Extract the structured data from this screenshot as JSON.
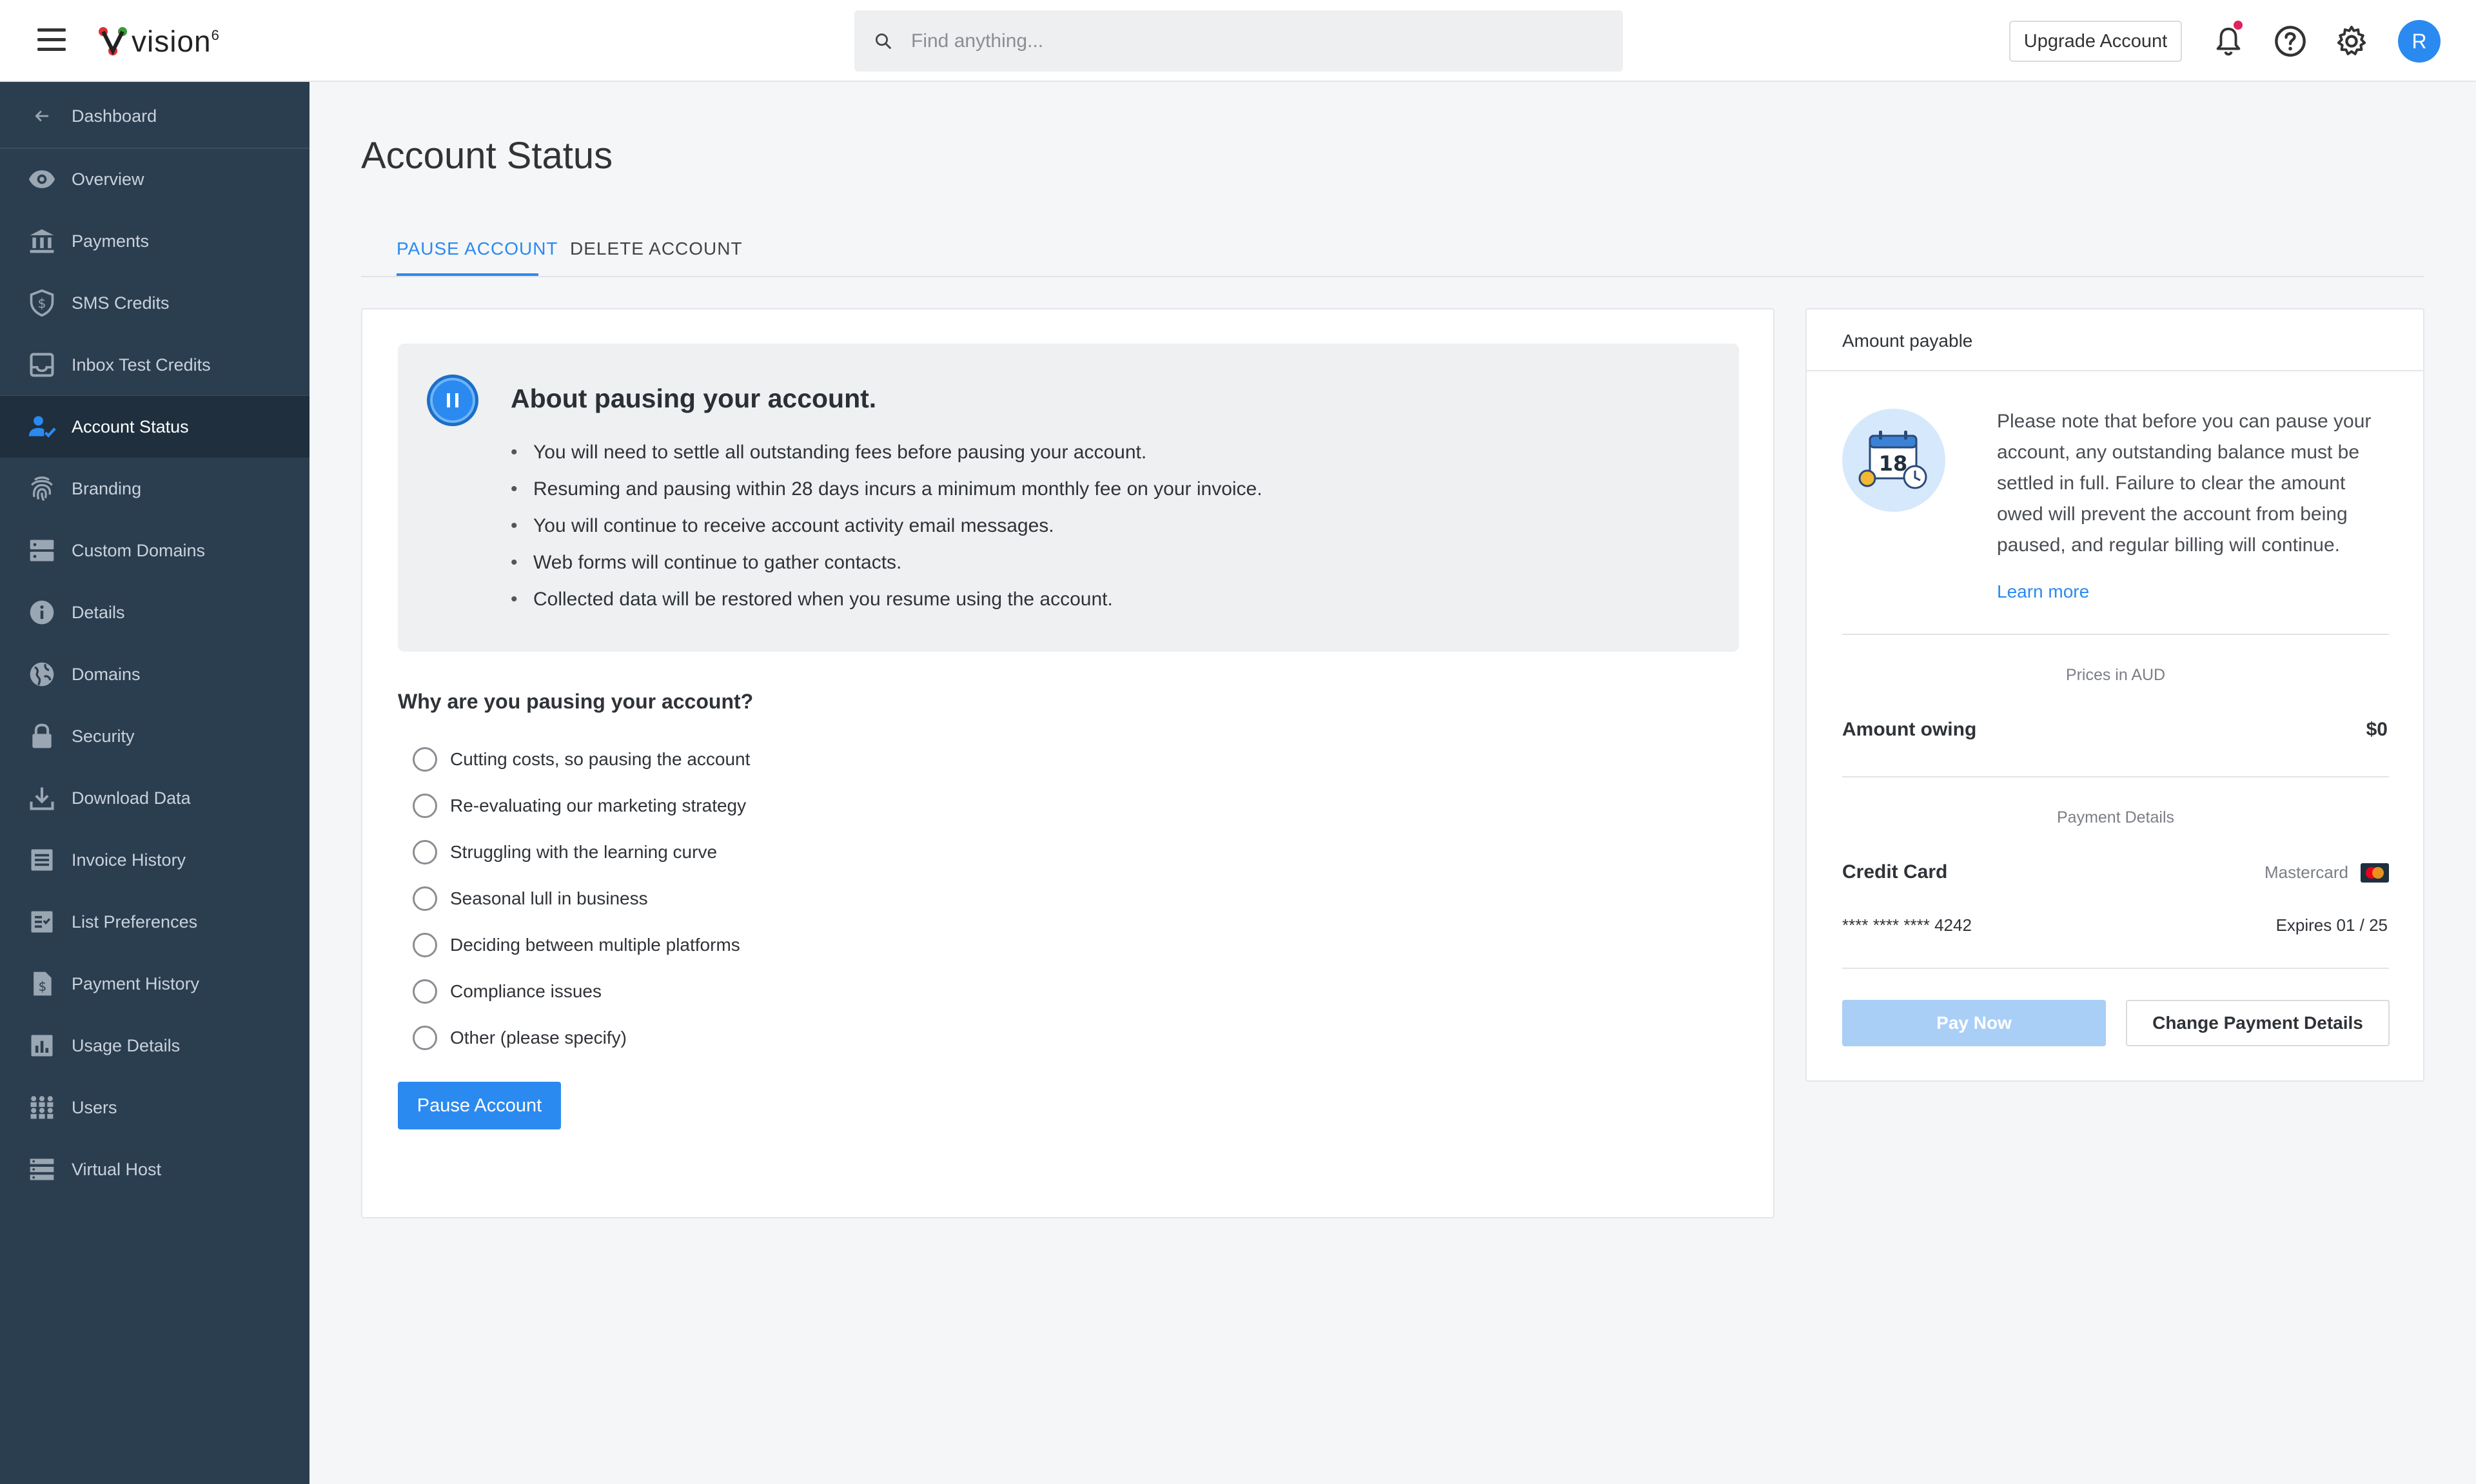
{
  "header": {
    "logo_text": "vision",
    "logo_sup": "6",
    "search_placeholder": "Find anything...",
    "upgrade_label": "Upgrade Account",
    "avatar_initial": "R"
  },
  "colors": {
    "accent": "#2b8af0",
    "sidebar_bg": "#2b3e50",
    "sidebar_active_bg": "#1f2f3e",
    "notification_dot": "#e0245e"
  },
  "sidebar": {
    "back_item": {
      "label": "Dashboard",
      "icon": "arrow-left-icon"
    },
    "items": [
      {
        "label": "Overview",
        "icon": "eye-icon"
      },
      {
        "label": "Payments",
        "icon": "bank-icon"
      },
      {
        "label": "SMS Credits",
        "icon": "shield-dollar-icon"
      },
      {
        "label": "Inbox Test Credits",
        "icon": "inbox-icon"
      },
      {
        "label": "Account Status",
        "icon": "user-check-icon",
        "active": true
      },
      {
        "label": "Branding",
        "icon": "fingerprint-icon"
      },
      {
        "label": "Custom Domains",
        "icon": "server-icon"
      },
      {
        "label": "Details",
        "icon": "info-icon"
      },
      {
        "label": "Domains",
        "icon": "globe-icon"
      },
      {
        "label": "Security",
        "icon": "lock-icon"
      },
      {
        "label": "Download Data",
        "icon": "download-icon"
      },
      {
        "label": "Invoice History",
        "icon": "list-icon"
      },
      {
        "label": "List Preferences",
        "icon": "checklist-icon"
      },
      {
        "label": "Payment History",
        "icon": "receipt-icon"
      },
      {
        "label": "Usage Details",
        "icon": "bar-chart-icon"
      },
      {
        "label": "Users",
        "icon": "users-icon"
      },
      {
        "label": "Virtual Host",
        "icon": "stack-icon"
      }
    ]
  },
  "main": {
    "title": "Account Status",
    "tabs": [
      {
        "label": "PAUSE ACCOUNT",
        "active": true
      },
      {
        "label": "DELETE ACCOUNT",
        "active": false
      }
    ],
    "info": {
      "title": "About pausing your account.",
      "points": [
        "You will need to settle all outstanding fees before pausing your account.",
        "Resuming and pausing within 28 days incurs a minimum monthly fee on your invoice.",
        "You will continue to receive account activity email messages.",
        "Web forms will continue to gather contacts.",
        "Collected data will be restored when you resume using the account."
      ]
    },
    "reasons_title": "Why are you pausing your account?",
    "reasons": [
      "Cutting costs, so pausing the account",
      "Re-evaluating our marketing strategy",
      "Struggling with the learning curve",
      "Seasonal lull in business",
      "Deciding between multiple platforms",
      "Compliance issues",
      "Other (please specify)"
    ],
    "pause_button": "Pause Account"
  },
  "payable": {
    "header": "Amount payable",
    "note": "Please note that before you can pause your account, any outstanding balance must be settled in full. Failure to clear the amount owed will prevent the account from being paused, and regular billing will continue.",
    "calendar_day": "18",
    "learn_more": "Learn more",
    "prices_in": "Prices in AUD",
    "amount_owing_label": "Amount owing",
    "amount_owing_value": "$0",
    "payment_details_label": "Payment Details",
    "card_label": "Credit Card",
    "card_brand": "Mastercard",
    "card_number": "**** **** **** 4242",
    "card_expiry": "Expires 01 / 25",
    "pay_now": "Pay Now",
    "change_payment": "Change Payment Details"
  }
}
